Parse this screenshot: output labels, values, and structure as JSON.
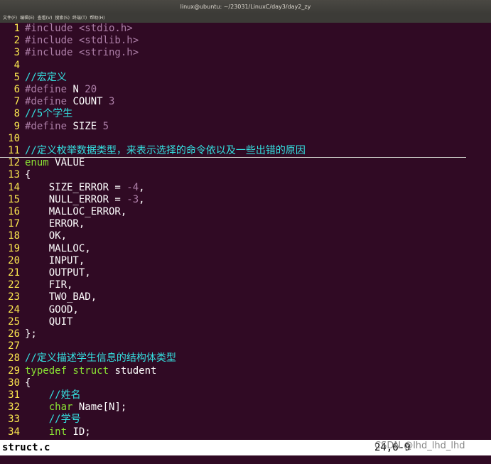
{
  "window": {
    "title": "linux@ubuntu: ~/23031/LinuxC/day3/day2_zy"
  },
  "menu": [
    "文件(F)",
    "编辑(E)",
    "查看(V)",
    "搜索(S)",
    "终端(T)",
    "帮助(H)"
  ],
  "colors": {
    "background": "#300a24",
    "line_number": "#fce94f",
    "preprocessor": "#ad7fa8",
    "string": "#ad7fa8",
    "comment": "#34e2e2",
    "type": "#8ae234",
    "text": "#ffffff",
    "status_bg": "#ffffff"
  },
  "code_lines": [
    {
      "n": "1",
      "parts": [
        {
          "t": "#include ",
          "c": "pre"
        },
        {
          "t": "<stdio.h>",
          "c": "str"
        }
      ]
    },
    {
      "n": "2",
      "parts": [
        {
          "t": "#include ",
          "c": "pre"
        },
        {
          "t": "<stdlib.h>",
          "c": "str"
        }
      ]
    },
    {
      "n": "3",
      "parts": [
        {
          "t": "#include ",
          "c": "pre"
        },
        {
          "t": "<string.h>",
          "c": "str"
        }
      ]
    },
    {
      "n": "4",
      "parts": []
    },
    {
      "n": "5",
      "parts": [
        {
          "t": "//宏定义",
          "c": "cmt"
        }
      ]
    },
    {
      "n": "6",
      "parts": [
        {
          "t": "#define ",
          "c": "pre"
        },
        {
          "t": "N ",
          "c": "txt"
        },
        {
          "t": "20",
          "c": "num"
        }
      ]
    },
    {
      "n": "7",
      "parts": [
        {
          "t": "#define ",
          "c": "pre"
        },
        {
          "t": "COUNT ",
          "c": "txt"
        },
        {
          "t": "3",
          "c": "num"
        }
      ]
    },
    {
      "n": "8",
      "parts": [
        {
          "t": "//5个学生",
          "c": "cmt"
        }
      ]
    },
    {
      "n": "9",
      "parts": [
        {
          "t": "#define ",
          "c": "pre"
        },
        {
          "t": "SIZE ",
          "c": "txt"
        },
        {
          "t": "5",
          "c": "num"
        }
      ]
    },
    {
      "n": "10",
      "parts": []
    },
    {
      "n": "11",
      "parts": [
        {
          "t": "//定义枚举数据类型，来表示选择的命令依以及一些出错的原因",
          "c": "cmt"
        }
      ],
      "cursor": true
    },
    {
      "n": "12",
      "parts": [
        {
          "t": "enum ",
          "c": "type"
        },
        {
          "t": "VALUE",
          "c": "txt"
        }
      ]
    },
    {
      "n": "13",
      "parts": [
        {
          "t": "{",
          "c": "txt"
        }
      ]
    },
    {
      "n": "14",
      "parts": [
        {
          "t": "    SIZE_ERROR = ",
          "c": "txt"
        },
        {
          "t": "-4",
          "c": "num"
        },
        {
          "t": ",",
          "c": "txt"
        }
      ]
    },
    {
      "n": "15",
      "parts": [
        {
          "t": "    NULL_ERROR = ",
          "c": "txt"
        },
        {
          "t": "-3",
          "c": "num"
        },
        {
          "t": ",",
          "c": "txt"
        }
      ]
    },
    {
      "n": "16",
      "parts": [
        {
          "t": "    MALLOC_ERROR,",
          "c": "txt"
        }
      ]
    },
    {
      "n": "17",
      "parts": [
        {
          "t": "    ERROR,",
          "c": "txt"
        }
      ]
    },
    {
      "n": "18",
      "parts": [
        {
          "t": "    OK,",
          "c": "txt"
        }
      ]
    },
    {
      "n": "19",
      "parts": [
        {
          "t": "    MALLOC,",
          "c": "txt"
        }
      ]
    },
    {
      "n": "20",
      "parts": [
        {
          "t": "    INPUT,",
          "c": "txt"
        }
      ]
    },
    {
      "n": "21",
      "parts": [
        {
          "t": "    OUTPUT,",
          "c": "txt"
        }
      ]
    },
    {
      "n": "22",
      "parts": [
        {
          "t": "    FIR,",
          "c": "txt"
        }
      ]
    },
    {
      "n": "23",
      "parts": [
        {
          "t": "    TWO_BAD,",
          "c": "txt"
        }
      ]
    },
    {
      "n": "24",
      "parts": [
        {
          "t": "    GOOD,",
          "c": "txt"
        }
      ]
    },
    {
      "n": "25",
      "parts": [
        {
          "t": "    QUIT",
          "c": "txt"
        }
      ]
    },
    {
      "n": "26",
      "parts": [
        {
          "t": "};",
          "c": "txt"
        }
      ]
    },
    {
      "n": "27",
      "parts": []
    },
    {
      "n": "28",
      "parts": [
        {
          "t": "//定义描述学生信息的结构体类型",
          "c": "cmt"
        }
      ]
    },
    {
      "n": "29",
      "parts": [
        {
          "t": "typedef struct ",
          "c": "type"
        },
        {
          "t": "student",
          "c": "txt"
        }
      ]
    },
    {
      "n": "30",
      "parts": [
        {
          "t": "{",
          "c": "txt"
        }
      ]
    },
    {
      "n": "31",
      "parts": [
        {
          "t": "    //姓名",
          "c": "cmt"
        }
      ]
    },
    {
      "n": "32",
      "parts": [
        {
          "t": "    ",
          "c": "txt"
        },
        {
          "t": "char ",
          "c": "type"
        },
        {
          "t": "Name[N];",
          "c": "txt"
        }
      ]
    },
    {
      "n": "33",
      "parts": [
        {
          "t": "    //学号",
          "c": "cmt"
        }
      ]
    },
    {
      "n": "34",
      "parts": [
        {
          "t": "    ",
          "c": "txt"
        },
        {
          "t": "int ",
          "c": "type"
        },
        {
          "t": "ID;",
          "c": "txt"
        }
      ]
    }
  ],
  "status": {
    "filename": "struct.c",
    "position": "24,6-9"
  },
  "watermark": "CSDN @lhd_lhd_lhd"
}
